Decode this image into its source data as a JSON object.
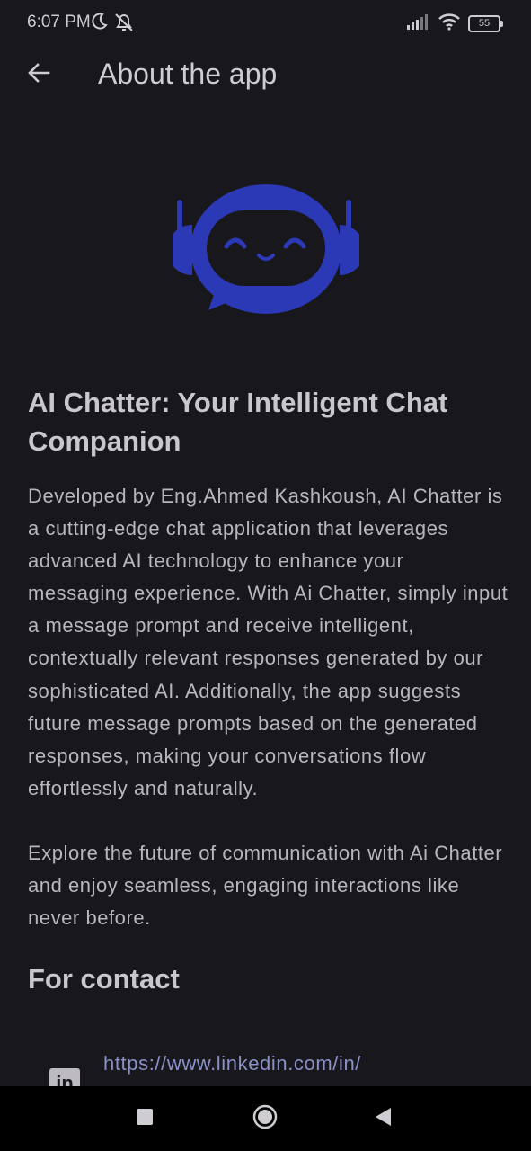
{
  "status_bar": {
    "time": "6:07 PM",
    "battery": "55",
    "icons": [
      "moon-icon",
      "notifications-off-icon",
      "signal-icon",
      "wifi-icon",
      "battery-icon"
    ]
  },
  "app_bar": {
    "title": "About the app",
    "back_icon": "arrow-back-icon"
  },
  "logo": {
    "icon": "robot-chat-logo",
    "color": "#2c39b6"
  },
  "about": {
    "headline": "AI Chatter: Your Intelligent Chat Companion",
    "paragraph1": "Developed by Eng.Ahmed Kashkoush, AI Chatter is a cutting-edge chat application that leverages advanced AI technology to enhance your messaging experience. With Ai Chatter, simply input a message prompt and receive intelligent, contextually relevant responses generated by our sophisticated AI. Additionally, the app suggests future message prompts based on the generated responses, making your conversations flow effortlessly and naturally.",
    "paragraph2": "Explore the future of communication with Ai Chatter and enjoy seamless, engaging interactions like never before."
  },
  "contact": {
    "heading": "For contact",
    "linkedin_icon": "linkedin-icon",
    "linkedin_url": "https://www.linkedin.com/in/"
  },
  "nav_bar": {
    "recents_icon": "square-icon",
    "home_icon": "circle-icon",
    "back_icon": "triangle-back-icon"
  },
  "colors": {
    "background": "#18181c",
    "text": "#c9c7cc",
    "link": "#8b90c8",
    "logo": "#2c39b6"
  }
}
